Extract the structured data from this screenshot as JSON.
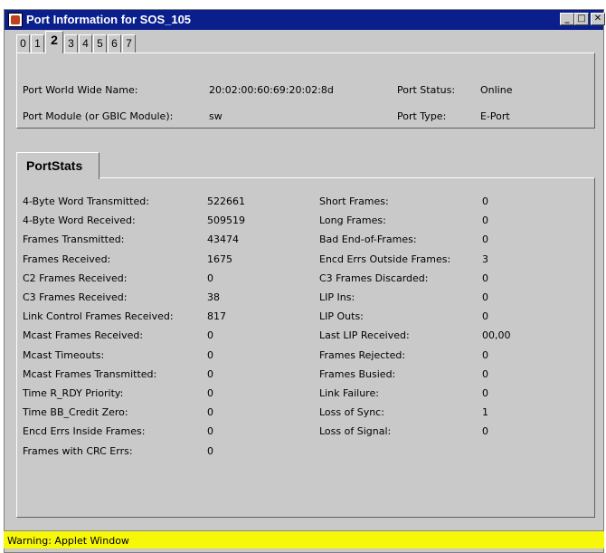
{
  "window": {
    "title": "Port Information for SOS_105"
  },
  "tabs": [
    "0",
    "1",
    "2",
    "3",
    "4",
    "5",
    "6",
    "7"
  ],
  "port_info": {
    "wwn_label": "Port World Wide Name:",
    "wwn_value": "20:02:00:60:69:20:02:8d",
    "module_label": "Port Module (or GBIC Module):",
    "module_value": "sw",
    "status_label": "Port Status:",
    "status_value": "Online",
    "type_label": "Port Type:",
    "type_value": "E-Port"
  },
  "portstats": {
    "tab_label": "PortStats",
    "left": [
      {
        "label": "4-Byte Word Transmitted:",
        "value": "522661"
      },
      {
        "label": "4-Byte Word Received:",
        "value": "509519"
      },
      {
        "label": "Frames Transmitted:",
        "value": "43474"
      },
      {
        "label": "Frames Received:",
        "value": "1675"
      },
      {
        "label": "C2 Frames Received:",
        "value": "0"
      },
      {
        "label": "C3 Frames Received:",
        "value": "38"
      },
      {
        "label": "Link Control Frames Received:",
        "value": "817"
      },
      {
        "label": "Mcast Frames Received:",
        "value": "0"
      },
      {
        "label": "Mcast Timeouts:",
        "value": "0"
      },
      {
        "label": "Mcast Frames Transmitted:",
        "value": "0"
      },
      {
        "label": "Time R_RDY Priority:",
        "value": "0"
      },
      {
        "label": "Time BB_Credit Zero:",
        "value": "0"
      },
      {
        "label": "Encd Errs Inside Frames:",
        "value": "0"
      },
      {
        "label": "Frames with CRC Errs:",
        "value": "0"
      }
    ],
    "right": [
      {
        "label": "Short Frames:",
        "value": "0"
      },
      {
        "label": "Long Frames:",
        "value": "0"
      },
      {
        "label": "Bad End-of-Frames:",
        "value": "0"
      },
      {
        "label": "Encd Errs Outside Frames:",
        "value": "3"
      },
      {
        "label": "C3 Frames Discarded:",
        "value": "0"
      },
      {
        "label": "LIP Ins:",
        "value": "0"
      },
      {
        "label": "LIP Outs:",
        "value": "0"
      },
      {
        "label": "Last LIP Received:",
        "value": "00,00"
      },
      {
        "label": "Frames Rejected:",
        "value": "0"
      },
      {
        "label": "Frames Busied:",
        "value": "0"
      },
      {
        "label": "Link Failure:",
        "value": "0"
      },
      {
        "label": "Loss of Sync:",
        "value": "1"
      },
      {
        "label": "Loss of Signal:",
        "value": "0"
      }
    ]
  },
  "status_bar": {
    "text": "Warning: Applet Window",
    "color": "#f7f70a"
  },
  "titlebar": {
    "color": "#0a1e8c",
    "minimize": "_",
    "maximize": "□",
    "close": "✕"
  }
}
